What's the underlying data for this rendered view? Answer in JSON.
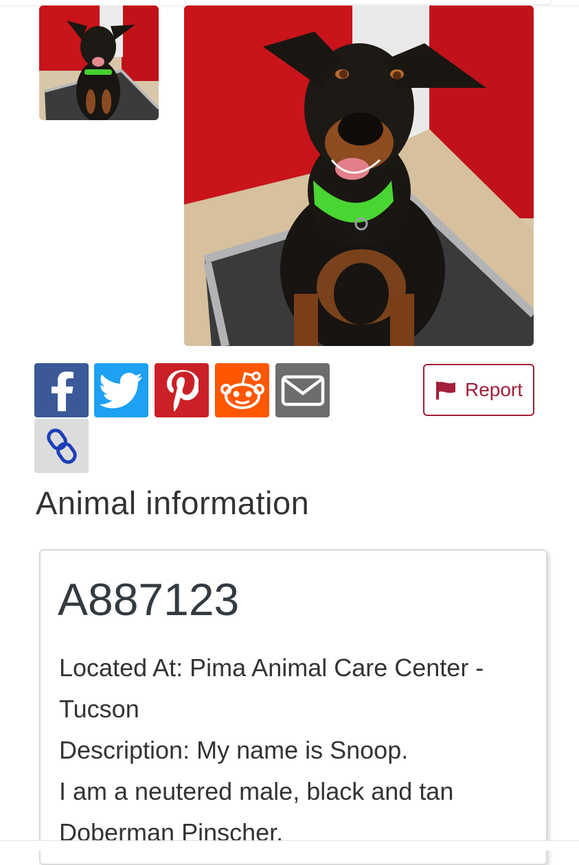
{
  "share": {
    "facebook_icon": "facebook-icon",
    "twitter_icon": "twitter-icon",
    "pinterest_icon": "pinterest-icon",
    "reddit_icon": "reddit-icon",
    "email_icon": "envelope-icon",
    "link_icon": "chain-link-icon",
    "colors": {
      "facebook": "#3b5998",
      "twitter": "#1da1f2",
      "pinterest": "#cb2027",
      "reddit": "#ff5700",
      "email": "#6d6d6d",
      "link": "#dcdcdc"
    }
  },
  "report": {
    "label": "Report",
    "icon": "flag-icon",
    "color": "#a31f39"
  },
  "section": {
    "title": "Animal information"
  },
  "animal": {
    "id": "A887123",
    "location_line": "Located At: Pima Animal Care Center - Tucson",
    "description_line": "Description: My name is Snoop.",
    "detail_line": "I am a neutered male, black and tan Doberman Pinscher."
  }
}
